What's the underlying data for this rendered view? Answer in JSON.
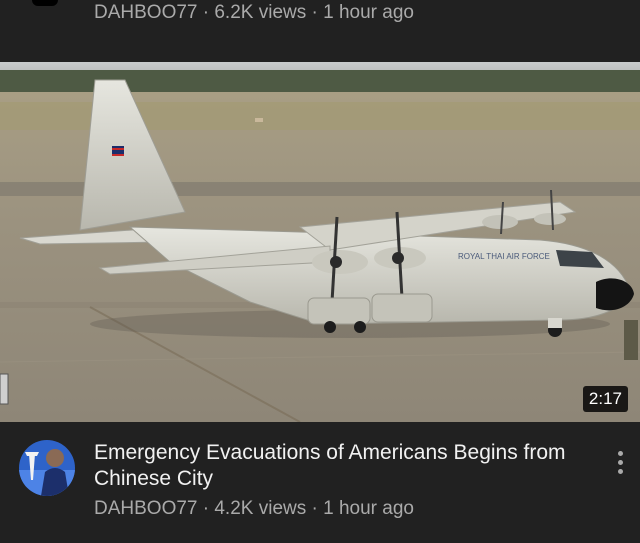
{
  "previous_video": {
    "meta": "DAHBOO77 · 6.2K views · 1 hour ago"
  },
  "video": {
    "title": "Emergency Evacuations of Americans Begins from Chinese City",
    "meta": "DAHBOO77 · 4.2K views · 1 hour ago",
    "duration": "2:17",
    "aircraft_markings": "ROYAL THAI AIR FORCE"
  },
  "colors": {
    "background": "#212121",
    "text_primary": "#f1f1f1",
    "text_secondary": "#aaaaaa"
  },
  "icons": {
    "more": "more-vert-icon"
  }
}
